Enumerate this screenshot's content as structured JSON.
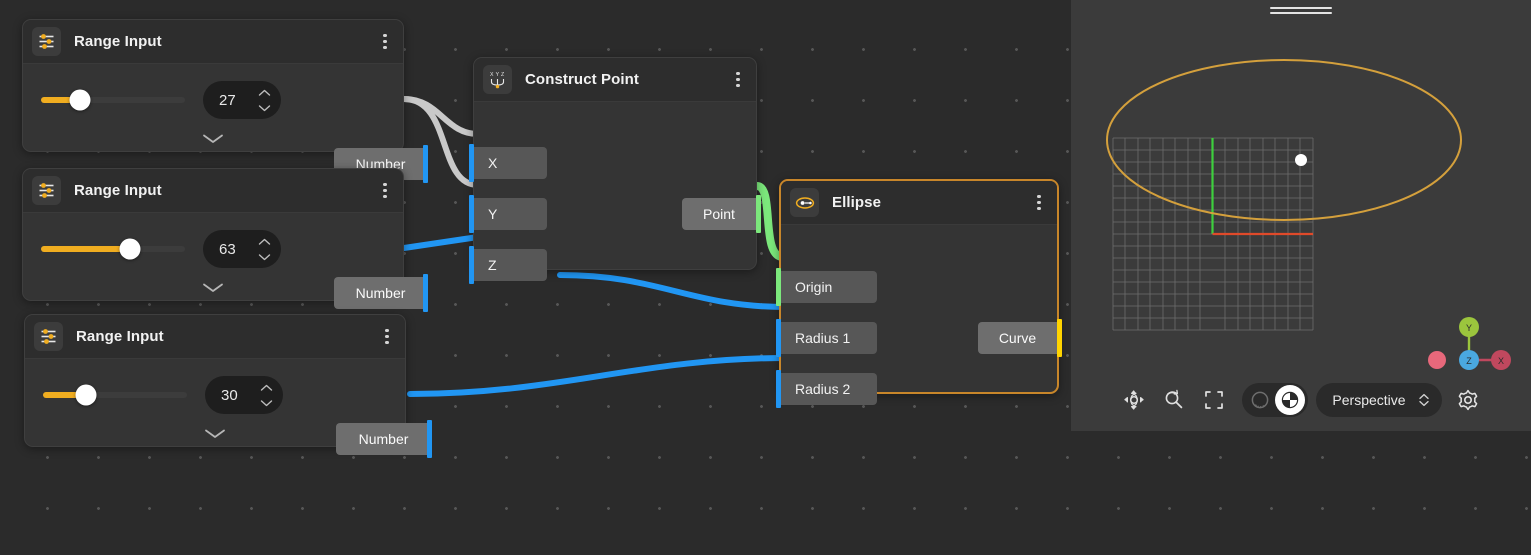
{
  "nodes": [
    {
      "id": "range-input-1",
      "title": "Range Input",
      "icon": "sliders-icon",
      "value": "27",
      "slider_percent": 27,
      "output_label": "Number",
      "output_type_color": "#2196f3",
      "selected": false
    },
    {
      "id": "range-input-2",
      "title": "Range Input",
      "icon": "sliders-icon",
      "value": "63",
      "slider_percent": 62,
      "output_label": "Number",
      "output_type_color": "#2196f3",
      "selected": false
    },
    {
      "id": "range-input-3",
      "title": "Range Input",
      "icon": "sliders-icon",
      "value": "30",
      "slider_percent": 30,
      "output_label": "Number",
      "output_type_color": "#2196f3",
      "selected": false
    },
    {
      "id": "construct-point",
      "title": "Construct Point",
      "icon": "xyz-point-icon",
      "inputs": [
        {
          "label": "X",
          "color": "#2196f3"
        },
        {
          "label": "Y",
          "color": "#2196f3"
        },
        {
          "label": "Z",
          "color": "#2196f3"
        }
      ],
      "outputs": [
        {
          "label": "Point",
          "color": "#7ce87c"
        }
      ],
      "selected": false
    },
    {
      "id": "ellipse",
      "title": "Ellipse",
      "icon": "ellipse-icon",
      "inputs": [
        {
          "label": "Origin",
          "color": "#7ce87c"
        },
        {
          "label": "Radius 1",
          "color": "#2196f3"
        },
        {
          "label": "Radius 2",
          "color": "#2196f3"
        }
      ],
      "outputs": [
        {
          "label": "Curve",
          "color": "#ffd400"
        }
      ],
      "selected": true,
      "selection_color": "#c8862a"
    }
  ],
  "viewport": {
    "projection_label": "Perspective",
    "toolbar": {
      "pan_orbit": "pan-orbit-icon",
      "zoom_select": "zoom-select-icon",
      "frame_all": "frame-all-icon",
      "shading_wireframe": "wireframe-shading-icon",
      "shading_shaded": "shaded-shading-icon",
      "settings": "gear-icon"
    },
    "axis_gizmo": {
      "x_label": "X",
      "y_label": "Y",
      "z_label": "Z",
      "x_color": "#c0485e",
      "y_color": "#9bc53d",
      "z_color": "#4aa8e0",
      "neg_x_color": "#f06a7e"
    },
    "scene": {
      "curve_color": "#d4a03c",
      "grid_color": "#8c8c8c",
      "axis_y_color": "#3ecf3e",
      "axis_x_color": "#e04a2a",
      "point_color": "#ffffff"
    }
  },
  "theme": {
    "canvas_bg": "#2b2b2b",
    "node_bg": "#343434",
    "header_bg": "#2d2d2d",
    "slider_accent": "#f0ad20",
    "wire_number": "#2196f3",
    "wire_generic": "#c9c9c9",
    "wire_point": "#7ce87c"
  }
}
